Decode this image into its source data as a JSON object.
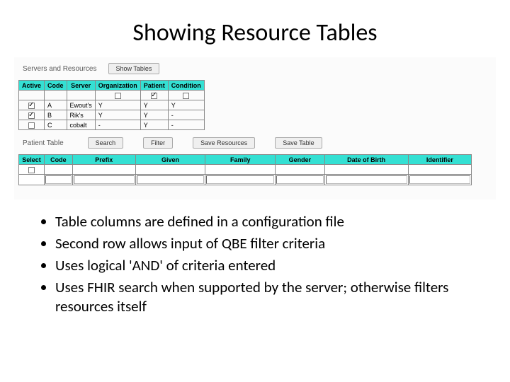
{
  "title": "Showing Resource Tables",
  "top": {
    "servers_label": "Servers and Resources",
    "show_tables_btn": "Show Tables"
  },
  "t1": {
    "headers": [
      "Active",
      "Code",
      "Server",
      "Organization",
      "Patient",
      "Condition"
    ],
    "row0": {
      "org_checked": false,
      "pat_checked": true,
      "cond_checked": false
    },
    "rows": [
      {
        "active": true,
        "code": "A",
        "server": "Ewout's",
        "org": "Y",
        "pat": "Y",
        "cond": "Y"
      },
      {
        "active": true,
        "code": "B",
        "server": "Rik's",
        "org": "Y",
        "pat": "Y",
        "cond": "-"
      },
      {
        "active": false,
        "code": "C",
        "server": "cobalt",
        "org": "-",
        "pat": "Y",
        "cond": "-"
      }
    ]
  },
  "toolbar2": {
    "patient_table": "Patient Table",
    "search": "Search",
    "filter": "Filter",
    "save_resources": "Save Resources",
    "save_table": "Save Table"
  },
  "t2": {
    "headers": {
      "select": "Select",
      "code": "Code",
      "prefix": "Prefix",
      "given": "Given",
      "family": "Family",
      "gender": "Gender",
      "dob": "Date of Birth",
      "identifier": "Identifier"
    },
    "row0_checked": false
  },
  "bullets": [
    "Table columns are defined in a configuration file",
    "Second row allows input of QBE filter criteria",
    "Uses logical 'AND' of criteria entered",
    "Uses FHIR search when supported by the server; otherwise filters resources itself"
  ]
}
